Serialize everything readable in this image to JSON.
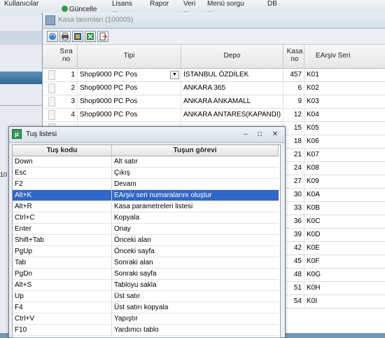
{
  "app_menu": [
    {
      "label": "Kullanıcılar",
      "sub": ""
    },
    {
      "label": "Güncelle",
      "sub": ""
    },
    {
      "label": "Lisans",
      "sub": "..."
    },
    {
      "label": "Rapor",
      "sub": ""
    },
    {
      "label": "Veri",
      "sub": "..."
    },
    {
      "label": "Menü sorgu",
      "sub": "..."
    },
    {
      "label": "DB",
      "sub": ""
    }
  ],
  "left_strip_text": "10",
  "kasa": {
    "title": "Kasa tanımları (100005)",
    "toolbar_icons": [
      "refresh-icon",
      "print-icon",
      "tools-icon",
      "excel-icon",
      "exit-icon"
    ],
    "columns": {
      "sira": "Sıra no",
      "tipi": "Tipi",
      "depo": "Depo",
      "kasa_no": "Kasa no",
      "earsiv": "EArşiv Seri"
    },
    "rows": [
      {
        "sira": "1",
        "tipi": "Shop9000 PC Pos",
        "depo": "İSTANBUL ÖZDİLEK",
        "kasa_no": "457",
        "earsiv": "K01"
      },
      {
        "sira": "2",
        "tipi": "Shop9000 PC Pos",
        "depo": "ANKARA 365",
        "kasa_no": "6",
        "earsiv": "K02"
      },
      {
        "sira": "3",
        "tipi": "Shop9000 PC Pos",
        "depo": "ANKARA ANKAMALL",
        "kasa_no": "9",
        "earsiv": "K03"
      },
      {
        "sira": "4",
        "tipi": "Shop9000 PC Pos",
        "depo": "ANKARA ANTARES(KAPANDI)",
        "kasa_no": "12",
        "earsiv": "K04"
      },
      {
        "sira": "",
        "tipi": "",
        "depo": "",
        "kasa_no": "15",
        "earsiv": "K05"
      },
      {
        "sira": "",
        "tipi": "",
        "depo": "",
        "kasa_no": "18",
        "earsiv": "K06"
      },
      {
        "sira": "",
        "tipi": "",
        "depo": "",
        "kasa_no": "21",
        "earsiv": "K07"
      },
      {
        "sira": "",
        "tipi": "",
        "depo": "",
        "kasa_no": "24",
        "earsiv": "K08"
      },
      {
        "sira": "",
        "tipi": "",
        "depo": "",
        "kasa_no": "27",
        "earsiv": "K09"
      },
      {
        "sira": "",
        "tipi": "",
        "depo": "",
        "kasa_no": "30",
        "earsiv": "K0A"
      },
      {
        "sira": "",
        "tipi": "",
        "depo": "",
        "kasa_no": "33",
        "earsiv": "K0B"
      },
      {
        "sira": "",
        "tipi": "",
        "depo": "",
        "kasa_no": "36",
        "earsiv": "K0C"
      },
      {
        "sira": "",
        "tipi": "",
        "depo": "",
        "kasa_no": "39",
        "earsiv": "K0D"
      },
      {
        "sira": "",
        "tipi": "",
        "depo": "",
        "kasa_no": "42",
        "earsiv": "K0E"
      },
      {
        "sira": "",
        "tipi": "",
        "depo": "",
        "kasa_no": "45",
        "earsiv": "K0F"
      },
      {
        "sira": "",
        "tipi": "",
        "depo": "",
        "kasa_no": "48",
        "earsiv": "K0G"
      },
      {
        "sira": "",
        "tipi": "",
        "depo": "",
        "kasa_no": "51",
        "earsiv": "K0H"
      },
      {
        "sira": "",
        "tipi": "",
        "depo": "",
        "kasa_no": "54",
        "earsiv": "K0I"
      }
    ]
  },
  "tus": {
    "title": "Tuş listesi",
    "controls": {
      "minimize": "–",
      "maximize": "□",
      "close": "✕"
    },
    "columns": {
      "kod": "Tuş kodu",
      "gorev": "Tuşun görevi"
    },
    "selected_index": 3,
    "rows": [
      {
        "kod": "Down",
        "gorev": "Alt satır"
      },
      {
        "kod": "Esc",
        "gorev": "Çıkış"
      },
      {
        "kod": "F2",
        "gorev": "Devam"
      },
      {
        "kod": "Alt+K",
        "gorev": "EArşiv seri numaralarını oluştur"
      },
      {
        "kod": "Alt+R",
        "gorev": "Kasa parametreleri listesi"
      },
      {
        "kod": "Ctrl+C",
        "gorev": "Kopyala"
      },
      {
        "kod": "Enter",
        "gorev": "Onay"
      },
      {
        "kod": "Shift+Tab",
        "gorev": "Önceki alan"
      },
      {
        "kod": "PgUp",
        "gorev": "Önceki sayfa"
      },
      {
        "kod": "Tab",
        "gorev": "Sonraki alan"
      },
      {
        "kod": "PgDn",
        "gorev": "Sonraki sayfa"
      },
      {
        "kod": "Alt+S",
        "gorev": "Tabloyu sakla"
      },
      {
        "kod": "Up",
        "gorev": "Üst satır"
      },
      {
        "kod": "F4",
        "gorev": "Üst satırı kopyala"
      },
      {
        "kod": "Ctrl+V",
        "gorev": "Yapıştır"
      },
      {
        "kod": "F10",
        "gorev": "Yardımcı tablo"
      }
    ]
  }
}
